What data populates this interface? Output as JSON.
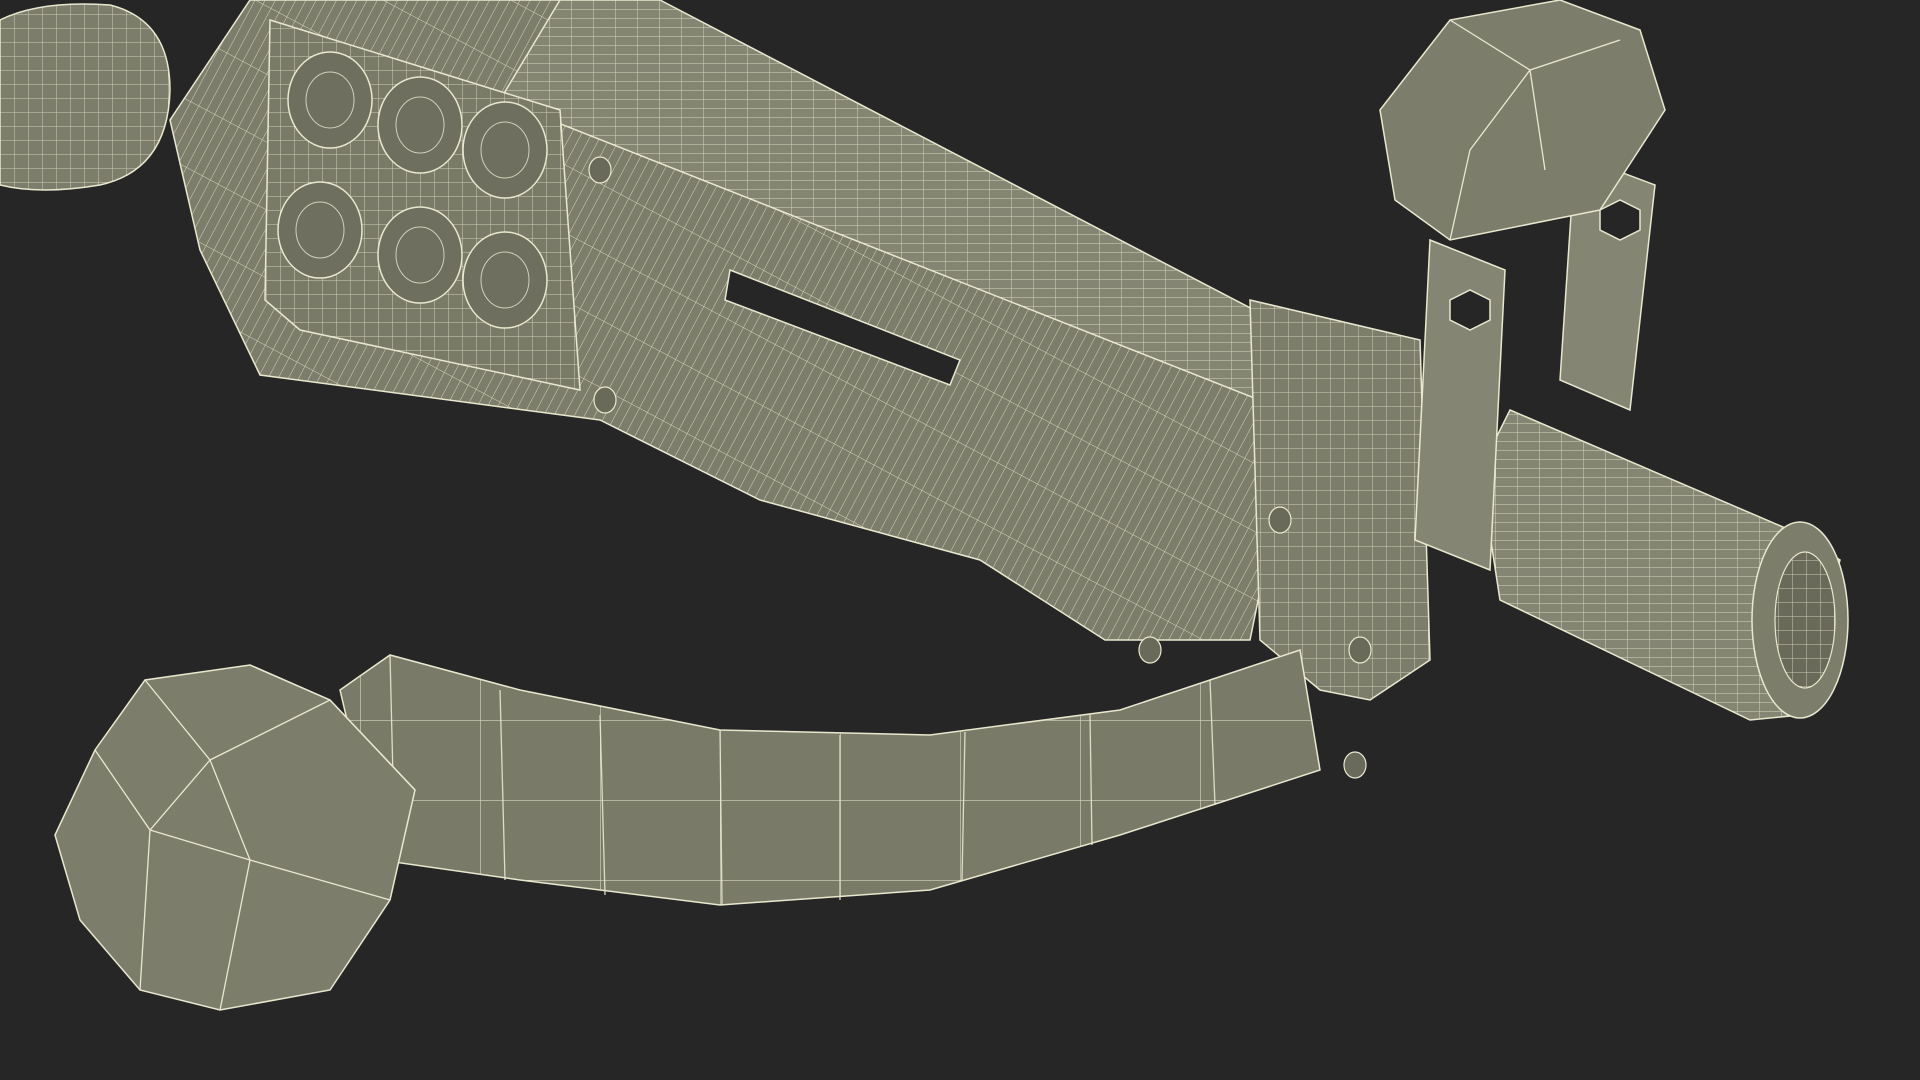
{
  "scene": {
    "subject": "crossbow-wireframe-render",
    "colors": {
      "background": "#262626",
      "surface": "#7d7d6c",
      "surface_light": "#8c8c79",
      "surface_dark": "#6a6a5b",
      "wire": "#e9e8cf"
    }
  }
}
